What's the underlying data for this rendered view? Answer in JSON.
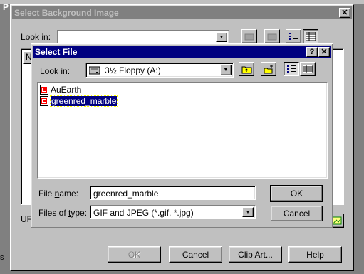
{
  "background_window": {
    "title_fragment": "P",
    "stray_fragment": "s"
  },
  "outer_dialog": {
    "title": "Select Background Image",
    "close_glyph": "✕",
    "look_in_label": "Look in:",
    "look_in_value": "",
    "column_header_fragment": "N",
    "url_label_fragment": "UF",
    "buttons": {
      "ok": "OK",
      "cancel": "Cancel",
      "clip_art": "Clip Art...",
      "help": "Help"
    }
  },
  "inner_dialog": {
    "title": "Select File",
    "help_glyph": "?",
    "close_glyph": "✕",
    "look_in_label": "Look in:",
    "look_in_value": "3½ Floppy (A:)",
    "files": [
      {
        "name": "AuEarth",
        "selected": false,
        "icon": "image-file-icon"
      },
      {
        "name": "greenred_marble",
        "selected": true,
        "icon": "image-file-icon"
      }
    ],
    "file_name_label": "File name:",
    "file_name_value": "greenred_marble",
    "files_of_type_label": "Files of type:",
    "files_of_type_value": "GIF and JPEG (*.gif, *.jpg)",
    "buttons": {
      "ok": "OK",
      "cancel": "Cancel"
    }
  },
  "colors": {
    "active_title": "#000080",
    "inactive_title": "#808080",
    "face": "#c0c0c0",
    "selection": "#000080"
  }
}
